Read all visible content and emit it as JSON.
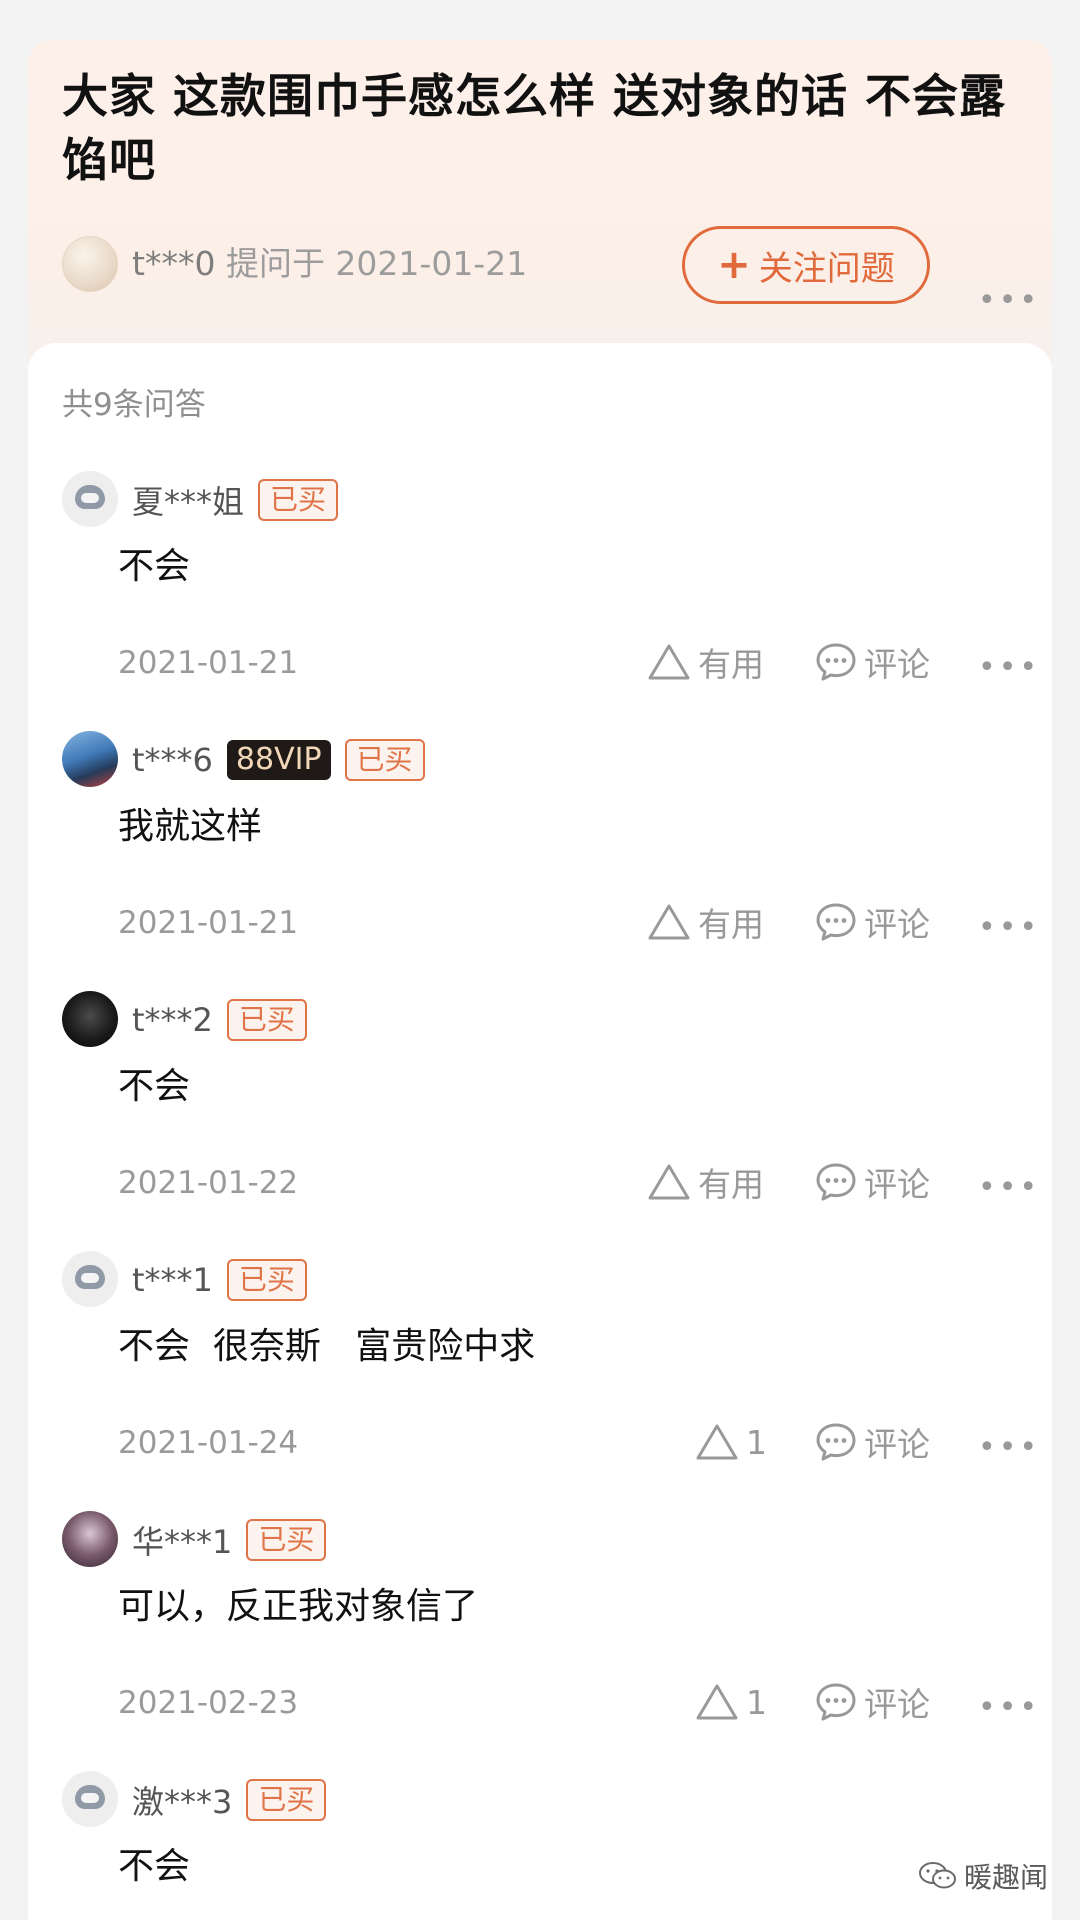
{
  "question": {
    "title": "大家 这款围巾手感怎么样  送对象的话  不会露馅吧",
    "asker": "t***0",
    "asked_meta": "提问于 2021-01-21",
    "follow_plus": "+",
    "follow_label": "关注问题",
    "more": "•••"
  },
  "answers_count": "共9条问答",
  "answers": [
    {
      "name": "夏***姐",
      "vip": null,
      "bought": "已买",
      "text": "不会",
      "date": "2021-01-21",
      "useful": "有用",
      "comment": "评论",
      "more": "•••"
    },
    {
      "name": "t***6",
      "vip": "88VIP",
      "bought": "已买",
      "text": "我就这样",
      "date": "2021-01-21",
      "useful": "有用",
      "comment": "评论",
      "more": "•••"
    },
    {
      "name": "t***2",
      "vip": null,
      "bought": "已买",
      "text": "不会",
      "date": "2021-01-22",
      "useful": "有用",
      "comment": "评论",
      "more": "•••"
    },
    {
      "name": "t***1",
      "vip": null,
      "bought": "已买",
      "text": "不会  很奈斯   富贵险中求",
      "date": "2021-01-24",
      "useful": "1",
      "comment": "评论",
      "more": "•••"
    },
    {
      "name": "华***1",
      "vip": null,
      "bought": "已买",
      "text": "可以，反正我对象信了",
      "date": "2021-02-23",
      "useful": "1",
      "comment": "评论",
      "more": "•••"
    },
    {
      "name": "激***3",
      "vip": null,
      "bought": "已买",
      "text": "不会"
    }
  ],
  "watermark": "暖趣闻",
  "colors": {
    "accent": "#e06a3b",
    "vip_bg": "#1f1a17",
    "vip_text": "#f1d7b8"
  }
}
